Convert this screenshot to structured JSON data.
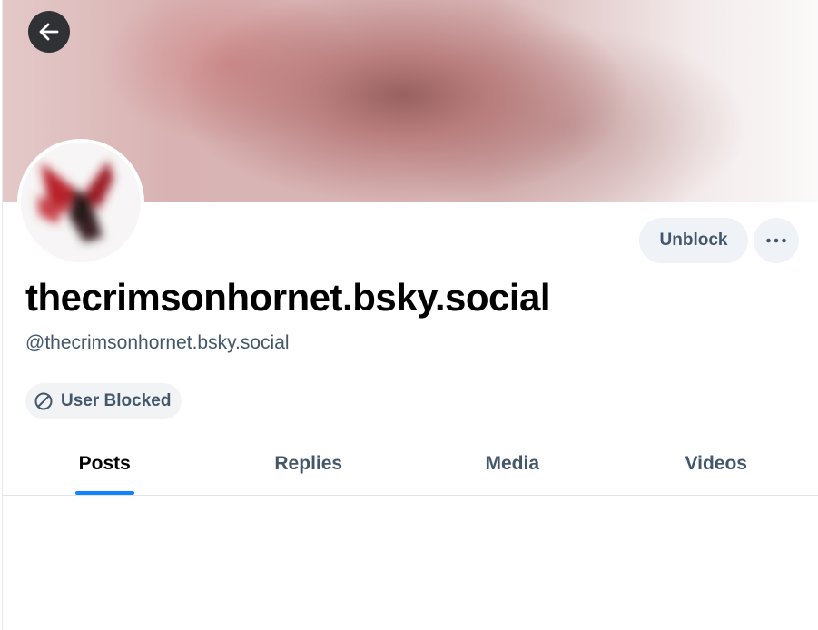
{
  "profile": {
    "display_name": "thecrimsonhornet.bsky.social",
    "handle": "@thecrimsonhornet.bsky.social",
    "blocked_label": "User Blocked"
  },
  "actions": {
    "unblock_label": "Unblock",
    "more_icon": "ellipsis-icon",
    "back_icon": "arrow-left-icon"
  },
  "tabs": [
    {
      "label": "Posts",
      "active": true
    },
    {
      "label": "Replies",
      "active": false
    },
    {
      "label": "Media",
      "active": false
    },
    {
      "label": "Videos",
      "active": false
    }
  ],
  "colors": {
    "accent": "#1083fe",
    "muted_text": "#42576c",
    "button_bg": "#eff2f6"
  }
}
